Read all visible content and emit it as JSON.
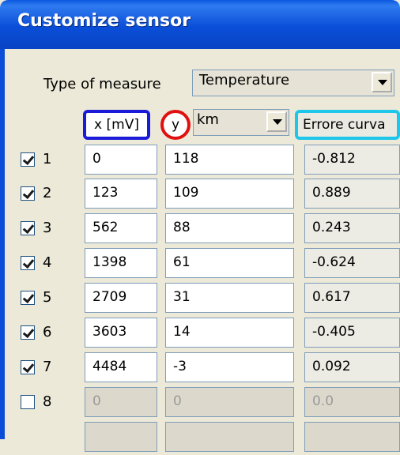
{
  "window": {
    "title": "Customize sensor"
  },
  "measure": {
    "label": "Type of measure",
    "selected": "Temperature"
  },
  "headers": {
    "x": "x [mV]",
    "y": "y",
    "unit": "km",
    "error": "Errore curva"
  },
  "rows": [
    {
      "checked": true,
      "num": "1",
      "x": "0",
      "y": "118",
      "err": "-0.812"
    },
    {
      "checked": true,
      "num": "2",
      "x": "123",
      "y": "109",
      "err": "0.889"
    },
    {
      "checked": true,
      "num": "3",
      "x": "562",
      "y": "88",
      "err": "0.243"
    },
    {
      "checked": true,
      "num": "4",
      "x": "1398",
      "y": "61",
      "err": "-0.624"
    },
    {
      "checked": true,
      "num": "5",
      "x": "2709",
      "y": "31",
      "err": "0.617"
    },
    {
      "checked": true,
      "num": "6",
      "x": "3603",
      "y": "14",
      "err": "-0.405"
    },
    {
      "checked": true,
      "num": "7",
      "x": "4484",
      "y": "-3",
      "err": "0.092"
    },
    {
      "checked": false,
      "num": "8",
      "x": "0",
      "y": "0",
      "err": "0.0"
    }
  ]
}
